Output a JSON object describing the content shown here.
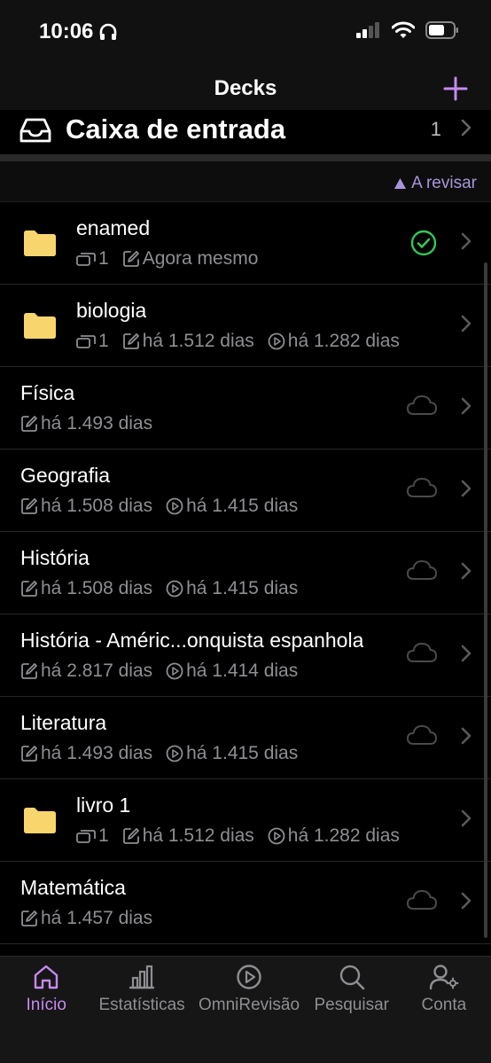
{
  "status": {
    "time": "10:06"
  },
  "nav": {
    "title": "Decks"
  },
  "inbox": {
    "label": "Caixa de entrada",
    "count": "1"
  },
  "sort": {
    "label": "A revisar"
  },
  "decks": [
    {
      "title": "enamed",
      "folder": true,
      "cards": "1",
      "edited": "Agora mesmo",
      "reviewed": "",
      "state": "synced"
    },
    {
      "title": "biologia",
      "folder": true,
      "cards": "1",
      "edited": "há 1.512 dias",
      "reviewed": "há 1.282 dias",
      "state": "none"
    },
    {
      "title": "Física",
      "folder": false,
      "cards": "",
      "edited": "há 1.493 dias",
      "reviewed": "",
      "state": "cloud"
    },
    {
      "title": "Geografia",
      "folder": false,
      "cards": "",
      "edited": "há 1.508 dias",
      "reviewed": "há 1.415 dias",
      "state": "cloud"
    },
    {
      "title": "História",
      "folder": false,
      "cards": "",
      "edited": "há 1.508 dias",
      "reviewed": "há 1.415 dias",
      "state": "cloud"
    },
    {
      "title": "História - Améric...onquista espanhola",
      "folder": false,
      "cards": "",
      "edited": "há 2.817 dias",
      "reviewed": "há 1.414 dias",
      "state": "cloud"
    },
    {
      "title": "Literatura",
      "folder": false,
      "cards": "",
      "edited": "há 1.493 dias",
      "reviewed": "há 1.415 dias",
      "state": "cloud"
    },
    {
      "title": "livro 1",
      "folder": true,
      "cards": "1",
      "edited": "há 1.512 dias",
      "reviewed": "há 1.282 dias",
      "state": "none"
    },
    {
      "title": "Matemática",
      "folder": false,
      "cards": "",
      "edited": "há 1.457 dias",
      "reviewed": "",
      "state": "cloud"
    }
  ],
  "tabs": [
    {
      "label": "Início",
      "icon": "home-icon",
      "active": true
    },
    {
      "label": "Estatísticas",
      "icon": "bar-chart-icon",
      "active": false
    },
    {
      "label": "OmniRevisão",
      "icon": "play-circle-icon",
      "active": false
    },
    {
      "label": "Pesquisar",
      "icon": "search-icon",
      "active": false
    },
    {
      "label": "Conta",
      "icon": "account-icon",
      "active": false
    }
  ],
  "colors": {
    "accent": "#c58af0",
    "sort": "#a995d9",
    "folder": "#f9d56e",
    "success": "#34c759"
  }
}
